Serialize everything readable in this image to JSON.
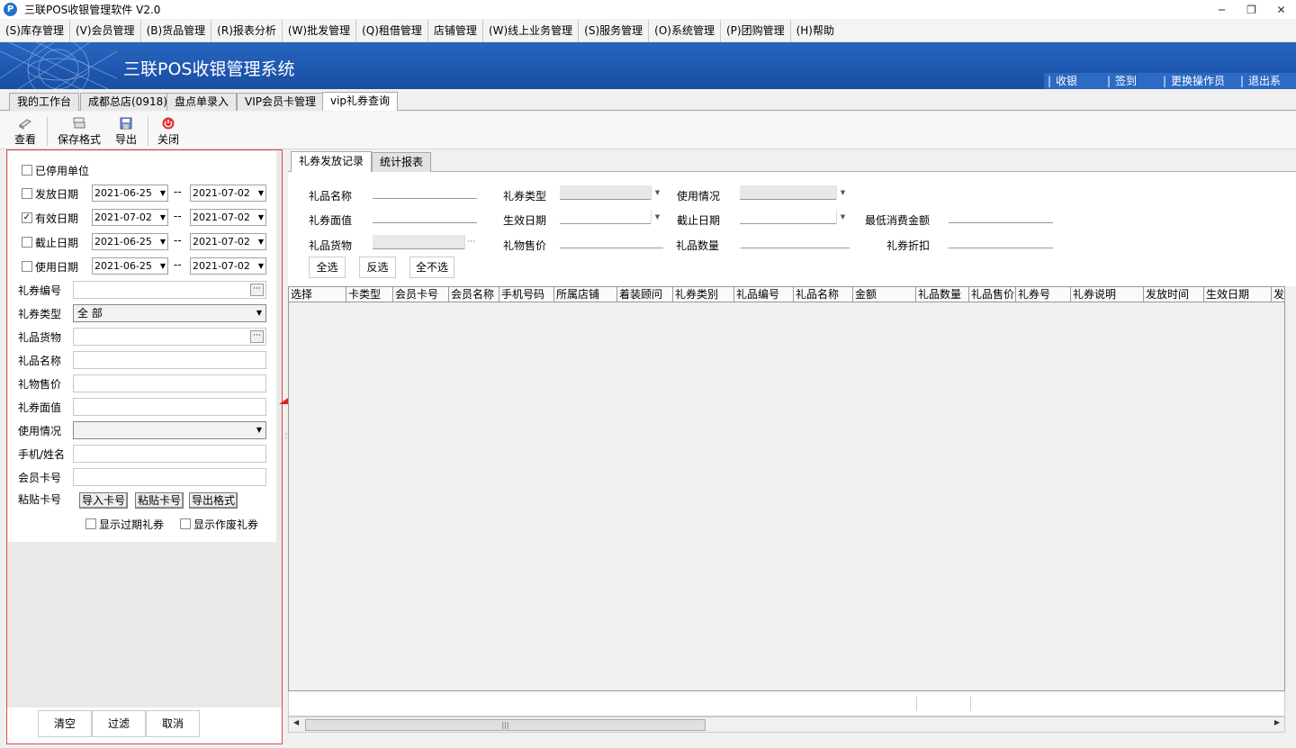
{
  "window": {
    "title": "三联POS收银管理软件 V2.0",
    "icon_letter": "P",
    "minimize": "─",
    "restore": "❐",
    "close": "✕"
  },
  "menu": [
    "(S)库存管理",
    "(V)会员管理",
    "(B)货品管理",
    "(R)报表分析",
    "(W)批发管理",
    "(Q)租借管理",
    "店铺管理",
    "(W)线上业务管理",
    "(S)服务管理",
    "(O)系统管理",
    "(P)团购管理",
    "(H)帮助"
  ],
  "banner": {
    "title": "三联POS收银管理系统",
    "actions": [
      "收银",
      "签到",
      "更换操作员",
      "退出系统"
    ]
  },
  "tabs": [
    "我的工作台",
    "成都总店(0918)",
    "盘点单录入",
    "VIP会员卡管理",
    "vip礼券查询"
  ],
  "toolbar": {
    "view": "查看",
    "save_format": "保存格式",
    "export": "导出",
    "close": "关闭"
  },
  "left": {
    "disabled_units": "已停用单位",
    "dash": "--",
    "issue_date": {
      "label": "发放日期",
      "from": "2021-06-25",
      "to": "2021-07-02",
      "checked": false
    },
    "valid_date": {
      "label": "有效日期",
      "from": "2021-07-02",
      "to": "2021-07-02",
      "checked": true
    },
    "expire_date": {
      "label": "截止日期",
      "from": "2021-06-25",
      "to": "2021-07-02",
      "checked": false
    },
    "use_date": {
      "label": "使用日期",
      "from": "2021-06-25",
      "to": "2021-07-02",
      "checked": false
    },
    "coupon_no": "礼券编号",
    "coupon_type": "礼券类型",
    "coupon_type_value": "全  部",
    "gift_goods": "礼品货物",
    "gift_name": "礼品名称",
    "gift_price": "礼物售价",
    "coupon_value": "礼券面值",
    "usage": "使用情况",
    "phone_name": "手机/姓名",
    "member_card": "会员卡号",
    "paste_card": "粘贴卡号",
    "import_card": "导入卡号",
    "paste_card_btn": "粘贴卡号",
    "export_format": "导出格式",
    "show_expired": "显示过期礼券",
    "show_void": "显示作废礼券",
    "clear": "清空",
    "filter": "过滤",
    "cancel": "取消"
  },
  "right": {
    "tabs": [
      "礼券发放记录",
      "统计报表"
    ],
    "filter": {
      "gift_name": "礼品名称",
      "coupon_type": "礼券类型",
      "usage": "使用情况",
      "coupon_value": "礼券面值",
      "effective_date": "生效日期",
      "expire_date": "截止日期",
      "min_spend": "最低消费金额",
      "gift_goods": "礼品货物",
      "gift_price": "礼物售价",
      "gift_qty": "礼品数量",
      "discount": "礼券折扣",
      "ellipsis": "···",
      "select_all": "全选",
      "invert": "反选",
      "select_none": "全不选"
    },
    "columns": [
      "选择",
      "卡类型",
      "会员卡号",
      "会员名称",
      "手机号码",
      "所属店铺",
      "着装顾问",
      "礼券类别",
      "礼品编号",
      "礼品名称",
      "金额",
      "礼品数量",
      "礼品售价",
      "礼券号",
      "礼券说明",
      "发放时间",
      "生效日期",
      "发"
    ],
    "scroll_thumb": "|||"
  }
}
